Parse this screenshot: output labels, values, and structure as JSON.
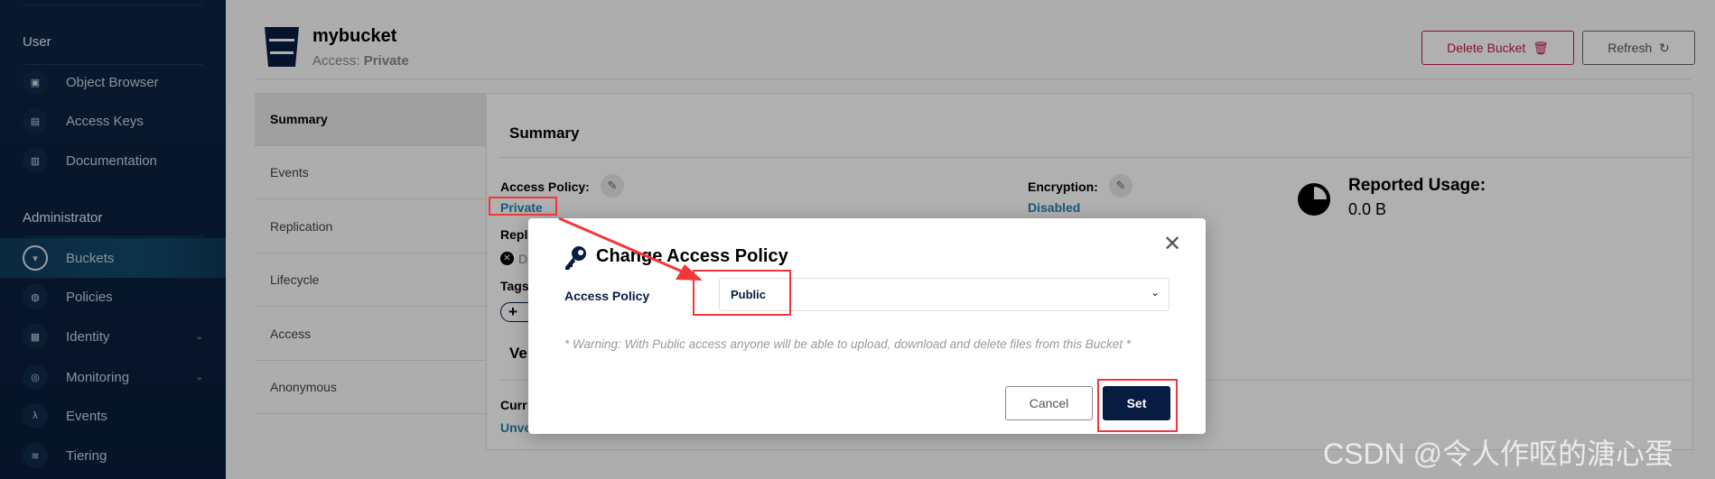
{
  "sidebar": {
    "user_section": "User",
    "user_items": [
      {
        "label": "Object Browser",
        "icon": "object-browser-icon"
      },
      {
        "label": "Access Keys",
        "icon": "access-keys-icon"
      },
      {
        "label": "Documentation",
        "icon": "documentation-icon"
      }
    ],
    "admin_section": "Administrator",
    "admin_items": [
      {
        "label": "Buckets",
        "icon": "bucket-icon",
        "active": true
      },
      {
        "label": "Policies",
        "icon": "policies-icon"
      },
      {
        "label": "Identity",
        "icon": "identity-icon",
        "expandable": true
      },
      {
        "label": "Monitoring",
        "icon": "monitoring-icon",
        "expandable": true
      },
      {
        "label": "Events",
        "icon": "lambda-icon"
      },
      {
        "label": "Tiering",
        "icon": "tiering-icon"
      }
    ]
  },
  "header": {
    "bucket_name": "mybucket",
    "access_label": "Access:",
    "access_value": "Private",
    "delete_button": "Delete Bucket",
    "refresh_button": "Refresh"
  },
  "tabs": [
    "Summary",
    "Events",
    "Replication",
    "Lifecycle",
    "Access",
    "Anonymous"
  ],
  "summary": {
    "title": "Summary",
    "access_policy_label": "Access Policy:",
    "access_policy_value": "Private",
    "replication_label": "Repl",
    "replication_value": "D",
    "tags_label": "Tags",
    "add_tag": "+",
    "versioning_title": "Ve",
    "current_label": "Curr",
    "current_value": "Unve",
    "encryption_label": "Encryption:",
    "encryption_value": "Disabled",
    "usage_label": "Reported Usage:",
    "usage_value": "0.0 B"
  },
  "modal": {
    "title": "Change Access Policy",
    "field_label": "Access Policy",
    "selected_option": "Public",
    "warning": "* Warning: With Public access anyone will be able to upload, download and delete files from this Bucket *",
    "cancel": "Cancel",
    "set": "Set"
  },
  "colors": {
    "sidebar": "#0a1c3a",
    "link": "#2781b0",
    "primary": "#081c42",
    "danger": "#c51b3f",
    "annotation": "#f2373a"
  },
  "watermark": "CSDN @令人作呕的溏心蛋"
}
